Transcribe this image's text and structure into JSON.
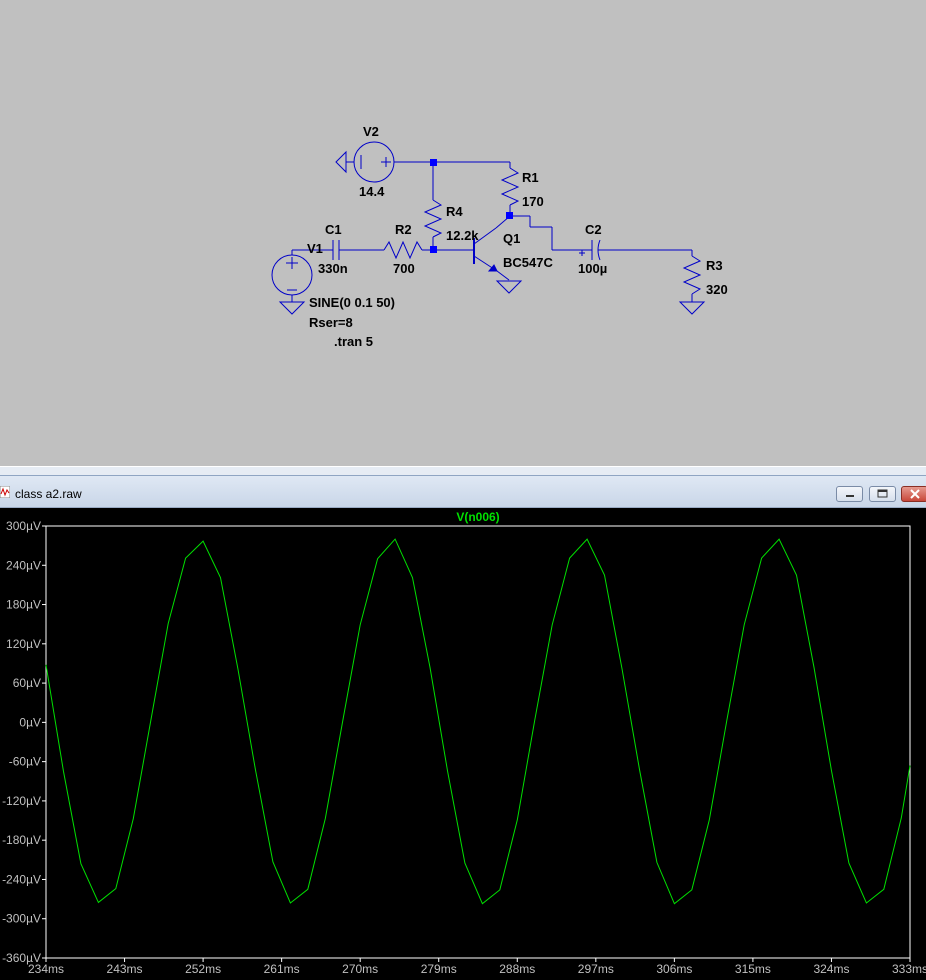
{
  "schematic": {
    "labels": {
      "v2_name": "V2",
      "v2_value": "14.4",
      "r1_name": "R1",
      "r1_value": "170",
      "r4_name": "R4",
      "r4_value": "12.2k",
      "q1_name": "Q1",
      "q1_model": "BC547C",
      "c1_name": "C1",
      "c1_value": "330n",
      "v1_name": "V1",
      "r2_name": "R2",
      "r2_value": "700",
      "c2_name": "C2",
      "c2_value": "100µ",
      "r3_name": "R3",
      "r3_value": "320",
      "v1_source": "SINE(0 0.1 50)",
      "v1_rser": "Rser=8",
      "directive": ".tran 5"
    },
    "wire_color": "#0000c8",
    "node_color": "#0000ff"
  },
  "window": {
    "title": "class a2.raw"
  },
  "chart_data": {
    "type": "line",
    "title": "V(n006)",
    "series": [
      {
        "name": "V(n006)",
        "color": "#00e000",
        "x": [
          234,
          236,
          238,
          240,
          242,
          244,
          246,
          248,
          250,
          252,
          254,
          256,
          258,
          260,
          262,
          264,
          266,
          268,
          270,
          272,
          274,
          276,
          278,
          280,
          282,
          284,
          286,
          288,
          290,
          292,
          294,
          296,
          298,
          300,
          302,
          304,
          306,
          308,
          310,
          312,
          314,
          316,
          318,
          320,
          322,
          324,
          326,
          328,
          330,
          332,
          333
        ],
        "y": [
          88,
          -75,
          -216,
          -275,
          -254,
          -147,
          2,
          151,
          251,
          277,
          221,
          81,
          -73,
          -213,
          -276,
          -255,
          -147,
          2,
          149,
          250,
          280,
          221,
          84,
          -74,
          -215,
          -277,
          -256,
          -149,
          3,
          149,
          251,
          280,
          225,
          82,
          -72,
          -214,
          -277,
          -256,
          -149,
          2,
          149,
          251,
          280,
          225,
          84,
          -74,
          -215,
          -276,
          -255,
          -146,
          -66
        ]
      }
    ],
    "xlim": [
      234,
      333
    ],
    "ylim": [
      -360,
      300
    ],
    "x_ticks": [
      "234ms",
      "243ms",
      "252ms",
      "261ms",
      "270ms",
      "279ms",
      "288ms",
      "297ms",
      "306ms",
      "315ms",
      "324ms",
      "333ms"
    ],
    "y_ticks": [
      "300µV",
      "240µV",
      "180µV",
      "120µV",
      "60µV",
      "0µV",
      "-60µV",
      "-120µV",
      "-180µV",
      "-240µV",
      "-300µV",
      "-360µV"
    ],
    "grid": false
  }
}
